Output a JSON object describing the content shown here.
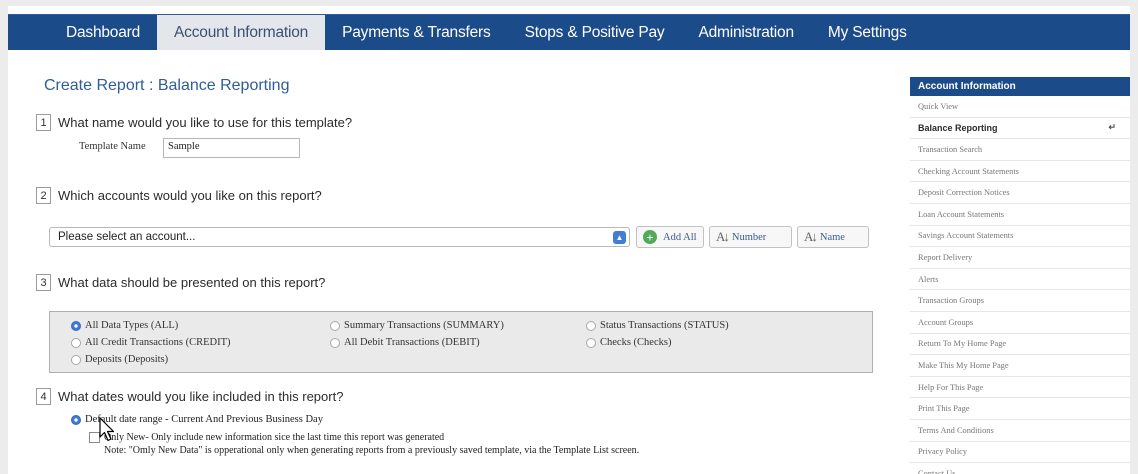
{
  "nav": {
    "tabs": [
      "Dashboard",
      "Account Information",
      "Payments & Transfers",
      "Stops & Positive Pay",
      "Administration",
      "My Settings"
    ],
    "active": "Account Information"
  },
  "page_title": "Create Report : Balance Reporting",
  "steps": [
    {
      "num": "1",
      "question": "What name would you like to use for this template?"
    },
    {
      "num": "2",
      "question": "Which accounts would you like on this report?"
    },
    {
      "num": "3",
      "question": "What data should be presented on this report?"
    },
    {
      "num": "4",
      "question": "What dates would you like included in this report?"
    }
  ],
  "template": {
    "label": "Template Name",
    "value": "Sample"
  },
  "accounts": {
    "select_value": "Please select an account...",
    "add_all": "Add All",
    "sort_number": "Number",
    "sort_name": "Name"
  },
  "data_types": [
    {
      "label": "All Data Types (ALL)",
      "checked": true
    },
    {
      "label": "Summary Transactions (SUMMARY)",
      "checked": false
    },
    {
      "label": "Status Transactions (STATUS)",
      "checked": false
    },
    {
      "label": "All Credit Transactions (CREDIT)",
      "checked": false
    },
    {
      "label": "All Debit Transactions (DEBIT)",
      "checked": false
    },
    {
      "label": "Checks (Checks)",
      "checked": false
    },
    {
      "label": "Deposits (Deposits)",
      "checked": false
    }
  ],
  "dates": {
    "default_option": "Default date range - Current And Previous Business Day",
    "only_new": "Only New- Only include new information sice the last time this report was generated",
    "note": "Note: \"Omly New Data\" is opperational only when generating reports from a previously saved template, via the Template List screen."
  },
  "sidebar": {
    "title": "Account Information",
    "items": [
      "Quick View",
      "Balance Reporting",
      "Transaction Search",
      "Checking Account Statements",
      "Deposit Correction Notices",
      "Loan Account Statements",
      "Savings Account Statements",
      "Report Delivery",
      "Alerts",
      "Transaction Groups",
      "Account Groups",
      "Return To My Home Page",
      "Make This My Home Page",
      "Help For This Page",
      "Print This Page",
      "Terms And Conditions",
      "Privacy Policy",
      "Contact Us"
    ],
    "active_item": "Balance Reporting"
  },
  "colors": {
    "nav_bg": "#1c4b8a",
    "title": "#2f5d9a",
    "active_tab_bg": "#e3e7ec"
  }
}
